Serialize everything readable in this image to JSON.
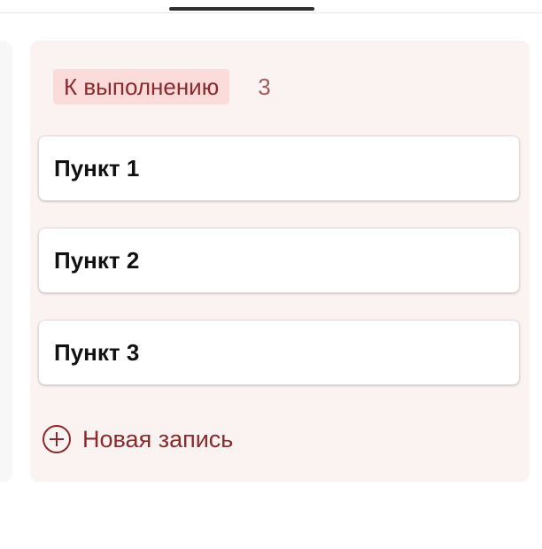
{
  "colors": {
    "column_background": "#fbf2f2",
    "status_pill_background": "#fcdcdb",
    "accent_text": "#8a2a2a",
    "count_text": "#a55b5b",
    "active_tab_indicator": "#2f2f2f"
  },
  "column": {
    "status_label": "К выполнению",
    "count": "3",
    "cards": [
      {
        "title": "Пункт 1"
      },
      {
        "title": "Пункт 2"
      },
      {
        "title": "Пункт 3"
      }
    ],
    "new_entry": {
      "icon": "plus-circle-icon",
      "label": "Новая запись"
    }
  }
}
